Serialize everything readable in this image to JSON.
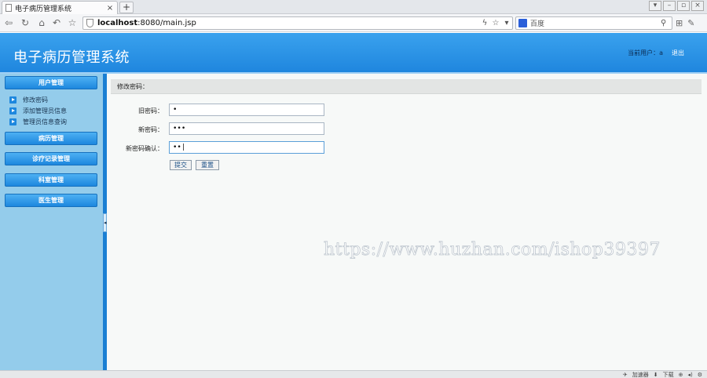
{
  "browser": {
    "tab_title": "电子病历管理系统",
    "tab_close": "×",
    "newtab": "+",
    "url_host": "localhost",
    "url_rest": ":8080/main.jsp",
    "search_placeholder": "百度",
    "window_buttons": [
      "▾",
      "–",
      "▫",
      "×"
    ]
  },
  "header": {
    "app_title": "电子病历管理系统",
    "user_label": "当前用户：",
    "user_name": "a",
    "logout": "退出"
  },
  "sidebar": {
    "menus": [
      {
        "label": "用户管理"
      },
      {
        "label": "病历管理"
      },
      {
        "label": "诊疗记录管理"
      },
      {
        "label": "科室管理"
      },
      {
        "label": "医生管理"
      }
    ],
    "subitems": [
      {
        "label": "修改密码"
      },
      {
        "label": "添加管理员信息"
      },
      {
        "label": "管理员信息查询"
      }
    ],
    "collapse": "◂"
  },
  "main": {
    "panel_title": "修改密码：",
    "fields": [
      {
        "label": "旧密码：",
        "value": "•"
      },
      {
        "label": "新密码：",
        "value": "•••"
      },
      {
        "label": "新密码确认：",
        "value": "••|"
      }
    ],
    "submit": "提交",
    "reset": "重置"
  },
  "watermark": "https://www.huzhan.com/ishop39397",
  "statusbar": {
    "items": [
      "加速器",
      "下载"
    ]
  }
}
